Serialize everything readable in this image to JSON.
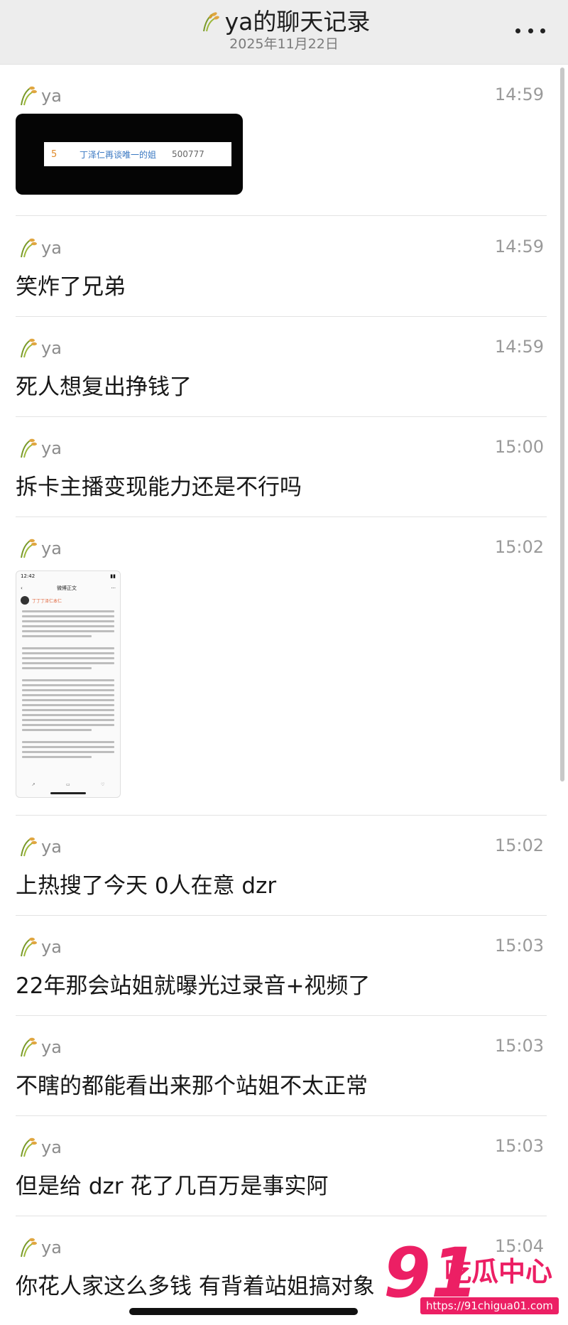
{
  "header": {
    "title": "ya的聊天记录",
    "date": "2025年11月22日",
    "more_icon": "more-dots-icon"
  },
  "messages": [
    {
      "sender": "ya",
      "time": "14:59",
      "type": "image",
      "image": {
        "rank": "5",
        "topic": "丁泽仁再谈唯一的姐",
        "heat": "500777"
      }
    },
    {
      "sender": "ya",
      "time": "14:59",
      "type": "text",
      "text": "笑炸了兄弟"
    },
    {
      "sender": "ya",
      "time": "14:59",
      "type": "text",
      "text": "死人想复出挣钱了"
    },
    {
      "sender": "ya",
      "time": "15:00",
      "type": "text",
      "text": "拆卡主播变现能力还是不行吗"
    },
    {
      "sender": "ya",
      "time": "15:02",
      "type": "image",
      "image": {
        "status_time": "12:42",
        "page_title": "微博正文",
        "user": "丁丁丁泽仁本仁"
      }
    },
    {
      "sender": "ya",
      "time": "15:02",
      "type": "text",
      "text": "上热搜了今天 0人在意 dzr"
    },
    {
      "sender": "ya",
      "time": "15:03",
      "type": "text",
      "text": "22年那会站姐就曝光过录音+视频了"
    },
    {
      "sender": "ya",
      "time": "15:03",
      "type": "text",
      "text": "不瞎的都能看出来那个站姐不太正常"
    },
    {
      "sender": "ya",
      "time": "15:03",
      "type": "text",
      "text": "但是给 dzr 花了几百万是事实阿"
    },
    {
      "sender": "ya",
      "time": "15:04",
      "type": "text",
      "text": "你花人家这么多钱 有背着站姐搞对象"
    }
  ],
  "watermark": {
    "number": "91",
    "text": "吃瓜中心",
    "url": "https://91chigua01.com"
  },
  "colors": {
    "header_bg": "#ededed",
    "divider": "#e3e3e3",
    "time": "#9a9a9a",
    "watermark": "#ec1f64"
  }
}
